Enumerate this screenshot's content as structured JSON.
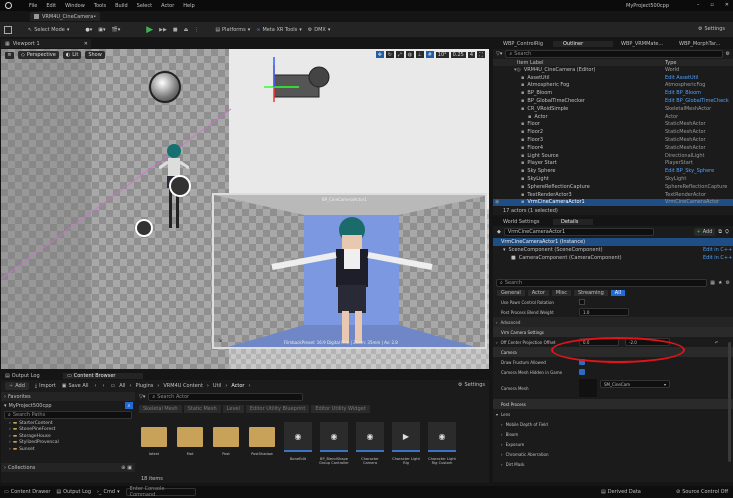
{
  "app": {
    "menu": [
      "File",
      "Edit",
      "Window",
      "Tools",
      "Build",
      "Select",
      "Actor",
      "Help"
    ],
    "tab": "VRM4U_CineCamera•",
    "project": "MyProject500cpp"
  },
  "toolbar": {
    "mode": "Select Mode",
    "platforms": "Platforms",
    "metaxr": "Meta XR Tools",
    "dmx": "DMX",
    "settings": "Settings"
  },
  "viewport": {
    "tab": "Viewport 1",
    "perspective": "Perspective",
    "lit": "Lit",
    "show": "Show",
    "snap_angle": "10°",
    "snap_scale": "0.25",
    "cam_speed": "4",
    "pip_top": "BP_CineCameraActor1",
    "pip_bottom": "FilmbackPreset: 16:9 Digital Film | Zoom: 35mm | Av: 2.8"
  },
  "right_tabs": [
    "WBP_ControlRig",
    "Outliner",
    "WBP_VRMMate...",
    "WBP_MorphTar..."
  ],
  "outliner": {
    "search": "Search",
    "col_label": "Item Label",
    "col_type": "Type",
    "rows": [
      {
        "label": "VRM4U_CineCamera (Editor)",
        "type": "World",
        "level": 1
      },
      {
        "label": "AssetUtil",
        "type": "Edit AssetUtil",
        "level": 2
      },
      {
        "label": "Atmospheric Fog",
        "type": "AtmosphericFog",
        "level": 2
      },
      {
        "label": "BP_Bloom",
        "type": "Edit BP_Bloom",
        "level": 2
      },
      {
        "label": "BP_GlobalTimeChecker",
        "type": "Edit BP_GlobalTimeCheck",
        "level": 2
      },
      {
        "label": "CR_VRoidSimple",
        "type": "SkeletalMeshActor",
        "level": 2
      },
      {
        "label": "Actor",
        "type": "Actor",
        "level": 3
      },
      {
        "label": "Floor",
        "type": "StaticMeshActor",
        "level": 2
      },
      {
        "label": "Floor2",
        "type": "StaticMeshActor",
        "level": 2
      },
      {
        "label": "Floor3",
        "type": "StaticMeshActor",
        "level": 2
      },
      {
        "label": "Floor4",
        "type": "StaticMeshActor",
        "level": 2
      },
      {
        "label": "Light Source",
        "type": "DirectionalLight",
        "level": 2
      },
      {
        "label": "Player Start",
        "type": "PlayerStart",
        "level": 2
      },
      {
        "label": "Sky Sphere",
        "type": "Edit BP_Sky_Sphere",
        "level": 2
      },
      {
        "label": "SkyLight",
        "type": "SkyLight",
        "level": 2
      },
      {
        "label": "SphereReflectionCapture",
        "type": "SphereReflectionCapture",
        "level": 2
      },
      {
        "label": "TextRenderActor3",
        "type": "TextRenderActor",
        "level": 2
      },
      {
        "label": "VrmCineCameraActor1",
        "type": "VrmCineCameraActor",
        "level": 2
      }
    ],
    "status": "17 actors (1 selected)"
  },
  "details": {
    "tabs": [
      "World Settings",
      "Details"
    ],
    "actor": "VrmCineCameraActor1",
    "add": "Add",
    "instance": "VrmCineCameraActor1 (Instance)",
    "comp1": "SceneComponent (SceneComponent)",
    "comp2": "CameraComponent (CameraComponent)",
    "edit_cpp": "Edit in C++",
    "search": "Search",
    "filters": [
      "General",
      "Actor",
      "Misc",
      "Streaming",
      "All"
    ],
    "rows": {
      "pawn": "Use Pawn Control Rotation",
      "blend": "Post Process Blend Weight",
      "blend_val": "1.0",
      "advanced": "Advanced",
      "vrm": "Vrm Camera Settings",
      "offset": "Off Center Projection Offset",
      "offx": "0.0",
      "offy": "-2.0",
      "camera": "Camera",
      "frustum": "Draw Frustum Allowed",
      "hidden": "Camera Mesh Hidden in Game",
      "mesh": "Camera Mesh",
      "mesh_val": "SM_CineCam",
      "pp": "Post Process",
      "lens": "Lens",
      "dof": "Mobile Depth of Field",
      "bloom": "Bloom",
      "exposure": "Exposure",
      "chroma": "Chromatic Aberration",
      "dirt": "Dirt Mask"
    }
  },
  "output_tabs": [
    "Output Log",
    "Content Browser"
  ],
  "content": {
    "add": "Add",
    "import": "Import",
    "saveall": "Save All",
    "path": [
      "All",
      "Plugins",
      "VRM4U Content",
      "Util",
      "Actor"
    ],
    "settings": "Settings",
    "favorites": "Favorites",
    "project": "MyProject500cpp",
    "search_paths": "Search Paths",
    "tree": [
      "StarterContent",
      "StonePineForest",
      "StorageHouse",
      "StylizedProvencal",
      "Sunset"
    ],
    "collections": "Collections",
    "search": "Search Actor",
    "filters": [
      "Skeletal Mesh",
      "Static Mesh",
      "Level",
      "Editor Utility Blueprint",
      "Editor Utility Widget"
    ],
    "items": [
      {
        "name": "latest",
        "kind": "folder"
      },
      {
        "name": "Mat",
        "kind": "folder"
      },
      {
        "name": "Post",
        "kind": "folder"
      },
      {
        "name": "PostShadow",
        "kind": "folder"
      },
      {
        "name": "BoneEdit",
        "kind": "bp"
      },
      {
        "name": "BP_BlendShape Group Controller",
        "kind": "bp"
      },
      {
        "name": "Character Camera",
        "kind": "bp"
      },
      {
        "name": "Character Light Rig",
        "kind": "bp"
      },
      {
        "name": "Character Light Rig Custom",
        "kind": "bp"
      }
    ],
    "count": "18 items"
  },
  "status": {
    "drawer": "Content Drawer",
    "log": "Output Log",
    "cmd": "Cmd",
    "console": "Enter Console Command",
    "derived": "Derived Data",
    "source": "Source Control Off"
  }
}
